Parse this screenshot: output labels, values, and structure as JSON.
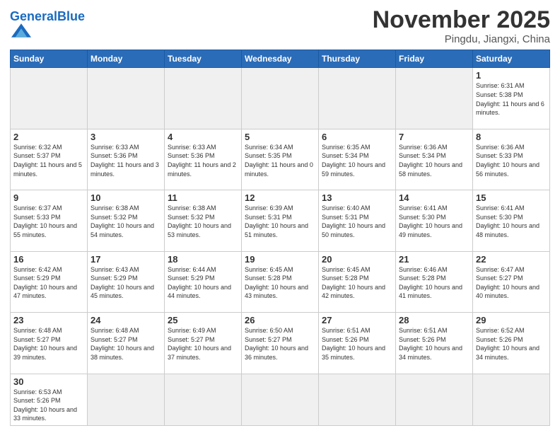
{
  "header": {
    "logo_general": "General",
    "logo_blue": "Blue",
    "month_title": "November 2025",
    "subtitle": "Pingdu, Jiangxi, China"
  },
  "weekdays": [
    "Sunday",
    "Monday",
    "Tuesday",
    "Wednesday",
    "Thursday",
    "Friday",
    "Saturday"
  ],
  "days": [
    {
      "num": "",
      "sunrise": "",
      "sunset": "",
      "daylight": "",
      "empty": true
    },
    {
      "num": "",
      "sunrise": "",
      "sunset": "",
      "daylight": "",
      "empty": true
    },
    {
      "num": "",
      "sunrise": "",
      "sunset": "",
      "daylight": "",
      "empty": true
    },
    {
      "num": "",
      "sunrise": "",
      "sunset": "",
      "daylight": "",
      "empty": true
    },
    {
      "num": "",
      "sunrise": "",
      "sunset": "",
      "daylight": "",
      "empty": true
    },
    {
      "num": "",
      "sunrise": "",
      "sunset": "",
      "daylight": "",
      "empty": true
    },
    {
      "num": "1",
      "sunrise": "Sunrise: 6:31 AM",
      "sunset": "Sunset: 5:38 PM",
      "daylight": "Daylight: 11 hours and 6 minutes.",
      "empty": false
    },
    {
      "num": "2",
      "sunrise": "Sunrise: 6:32 AM",
      "sunset": "Sunset: 5:37 PM",
      "daylight": "Daylight: 11 hours and 5 minutes.",
      "empty": false
    },
    {
      "num": "3",
      "sunrise": "Sunrise: 6:33 AM",
      "sunset": "Sunset: 5:36 PM",
      "daylight": "Daylight: 11 hours and 3 minutes.",
      "empty": false
    },
    {
      "num": "4",
      "sunrise": "Sunrise: 6:33 AM",
      "sunset": "Sunset: 5:36 PM",
      "daylight": "Daylight: 11 hours and 2 minutes.",
      "empty": false
    },
    {
      "num": "5",
      "sunrise": "Sunrise: 6:34 AM",
      "sunset": "Sunset: 5:35 PM",
      "daylight": "Daylight: 11 hours and 0 minutes.",
      "empty": false
    },
    {
      "num": "6",
      "sunrise": "Sunrise: 6:35 AM",
      "sunset": "Sunset: 5:34 PM",
      "daylight": "Daylight: 10 hours and 59 minutes.",
      "empty": false
    },
    {
      "num": "7",
      "sunrise": "Sunrise: 6:36 AM",
      "sunset": "Sunset: 5:34 PM",
      "daylight": "Daylight: 10 hours and 58 minutes.",
      "empty": false
    },
    {
      "num": "8",
      "sunrise": "Sunrise: 6:36 AM",
      "sunset": "Sunset: 5:33 PM",
      "daylight": "Daylight: 10 hours and 56 minutes.",
      "empty": false
    },
    {
      "num": "9",
      "sunrise": "Sunrise: 6:37 AM",
      "sunset": "Sunset: 5:33 PM",
      "daylight": "Daylight: 10 hours and 55 minutes.",
      "empty": false
    },
    {
      "num": "10",
      "sunrise": "Sunrise: 6:38 AM",
      "sunset": "Sunset: 5:32 PM",
      "daylight": "Daylight: 10 hours and 54 minutes.",
      "empty": false
    },
    {
      "num": "11",
      "sunrise": "Sunrise: 6:38 AM",
      "sunset": "Sunset: 5:32 PM",
      "daylight": "Daylight: 10 hours and 53 minutes.",
      "empty": false
    },
    {
      "num": "12",
      "sunrise": "Sunrise: 6:39 AM",
      "sunset": "Sunset: 5:31 PM",
      "daylight": "Daylight: 10 hours and 51 minutes.",
      "empty": false
    },
    {
      "num": "13",
      "sunrise": "Sunrise: 6:40 AM",
      "sunset": "Sunset: 5:31 PM",
      "daylight": "Daylight: 10 hours and 50 minutes.",
      "empty": false
    },
    {
      "num": "14",
      "sunrise": "Sunrise: 6:41 AM",
      "sunset": "Sunset: 5:30 PM",
      "daylight": "Daylight: 10 hours and 49 minutes.",
      "empty": false
    },
    {
      "num": "15",
      "sunrise": "Sunrise: 6:41 AM",
      "sunset": "Sunset: 5:30 PM",
      "daylight": "Daylight: 10 hours and 48 minutes.",
      "empty": false
    },
    {
      "num": "16",
      "sunrise": "Sunrise: 6:42 AM",
      "sunset": "Sunset: 5:29 PM",
      "daylight": "Daylight: 10 hours and 47 minutes.",
      "empty": false
    },
    {
      "num": "17",
      "sunrise": "Sunrise: 6:43 AM",
      "sunset": "Sunset: 5:29 PM",
      "daylight": "Daylight: 10 hours and 45 minutes.",
      "empty": false
    },
    {
      "num": "18",
      "sunrise": "Sunrise: 6:44 AM",
      "sunset": "Sunset: 5:29 PM",
      "daylight": "Daylight: 10 hours and 44 minutes.",
      "empty": false
    },
    {
      "num": "19",
      "sunrise": "Sunrise: 6:45 AM",
      "sunset": "Sunset: 5:28 PM",
      "daylight": "Daylight: 10 hours and 43 minutes.",
      "empty": false
    },
    {
      "num": "20",
      "sunrise": "Sunrise: 6:45 AM",
      "sunset": "Sunset: 5:28 PM",
      "daylight": "Daylight: 10 hours and 42 minutes.",
      "empty": false
    },
    {
      "num": "21",
      "sunrise": "Sunrise: 6:46 AM",
      "sunset": "Sunset: 5:28 PM",
      "daylight": "Daylight: 10 hours and 41 minutes.",
      "empty": false
    },
    {
      "num": "22",
      "sunrise": "Sunrise: 6:47 AM",
      "sunset": "Sunset: 5:27 PM",
      "daylight": "Daylight: 10 hours and 40 minutes.",
      "empty": false
    },
    {
      "num": "23",
      "sunrise": "Sunrise: 6:48 AM",
      "sunset": "Sunset: 5:27 PM",
      "daylight": "Daylight: 10 hours and 39 minutes.",
      "empty": false
    },
    {
      "num": "24",
      "sunrise": "Sunrise: 6:48 AM",
      "sunset": "Sunset: 5:27 PM",
      "daylight": "Daylight: 10 hours and 38 minutes.",
      "empty": false
    },
    {
      "num": "25",
      "sunrise": "Sunrise: 6:49 AM",
      "sunset": "Sunset: 5:27 PM",
      "daylight": "Daylight: 10 hours and 37 minutes.",
      "empty": false
    },
    {
      "num": "26",
      "sunrise": "Sunrise: 6:50 AM",
      "sunset": "Sunset: 5:27 PM",
      "daylight": "Daylight: 10 hours and 36 minutes.",
      "empty": false
    },
    {
      "num": "27",
      "sunrise": "Sunrise: 6:51 AM",
      "sunset": "Sunset: 5:26 PM",
      "daylight": "Daylight: 10 hours and 35 minutes.",
      "empty": false
    },
    {
      "num": "28",
      "sunrise": "Sunrise: 6:51 AM",
      "sunset": "Sunset: 5:26 PM",
      "daylight": "Daylight: 10 hours and 34 minutes.",
      "empty": false
    },
    {
      "num": "29",
      "sunrise": "Sunrise: 6:52 AM",
      "sunset": "Sunset: 5:26 PM",
      "daylight": "Daylight: 10 hours and 34 minutes.",
      "empty": false
    },
    {
      "num": "30",
      "sunrise": "Sunrise: 6:53 AM",
      "sunset": "Sunset: 5:26 PM",
      "daylight": "Daylight: 10 hours and 33 minutes.",
      "empty": false
    },
    {
      "num": "",
      "sunrise": "",
      "sunset": "",
      "daylight": "",
      "empty": true
    },
    {
      "num": "",
      "sunrise": "",
      "sunset": "",
      "daylight": "",
      "empty": true
    },
    {
      "num": "",
      "sunrise": "",
      "sunset": "",
      "daylight": "",
      "empty": true
    },
    {
      "num": "",
      "sunrise": "",
      "sunset": "",
      "daylight": "",
      "empty": true
    },
    {
      "num": "",
      "sunrise": "",
      "sunset": "",
      "daylight": "",
      "empty": true
    },
    {
      "num": "",
      "sunrise": "",
      "sunset": "",
      "daylight": "",
      "empty": true
    }
  ]
}
